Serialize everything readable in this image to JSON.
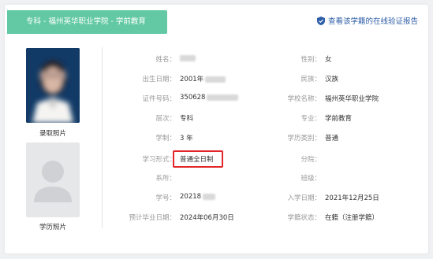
{
  "header": {
    "banner_text": "专科 - 福州英华职业学院 - 学前教育",
    "report_link": "查看该学籍的在线验证报告"
  },
  "photos": {
    "enrollment_label": "录取照片",
    "graduation_label": "学历照片"
  },
  "left_fields": [
    {
      "label": "姓名：",
      "value": "",
      "blurred": true
    },
    {
      "label": "出生日期：",
      "value": "2001年",
      "blurred": true
    },
    {
      "label": "证件号码：",
      "value": "350628",
      "blurred": true
    },
    {
      "label": "层次：",
      "value": "专科"
    },
    {
      "label": "学制：",
      "value": "3 年"
    },
    {
      "label": "学习形式：",
      "value": "普通全日制"
    },
    {
      "label": "系所：",
      "value": ""
    },
    {
      "label": "学号：",
      "value": "20218",
      "blurred": true
    },
    {
      "label": "预计毕业日期：",
      "value": "2024年06月30日"
    }
  ],
  "right_fields": [
    {
      "label": "性别：",
      "value": "女"
    },
    {
      "label": "民族：",
      "value": "汉族"
    },
    {
      "label": "学校名称：",
      "value": "福州英华职业学院"
    },
    {
      "label": "专业：",
      "value": "学前教育"
    },
    {
      "label": "学历类别：",
      "value": "普通"
    },
    {
      "label": "分院：",
      "value": ""
    },
    {
      "label": "班级：",
      "value": ""
    },
    {
      "label": "入学日期：",
      "value": "2021年12月25日"
    },
    {
      "label": "学籍状态：",
      "value": "在籍（注册学籍）"
    }
  ],
  "colors": {
    "banner": "#62c9a4",
    "link": "#2d5da7",
    "highlight": "#e2262a"
  },
  "icons": {
    "report": "shield-check-icon",
    "avatar_placeholder": "person-silhouette-icon"
  }
}
